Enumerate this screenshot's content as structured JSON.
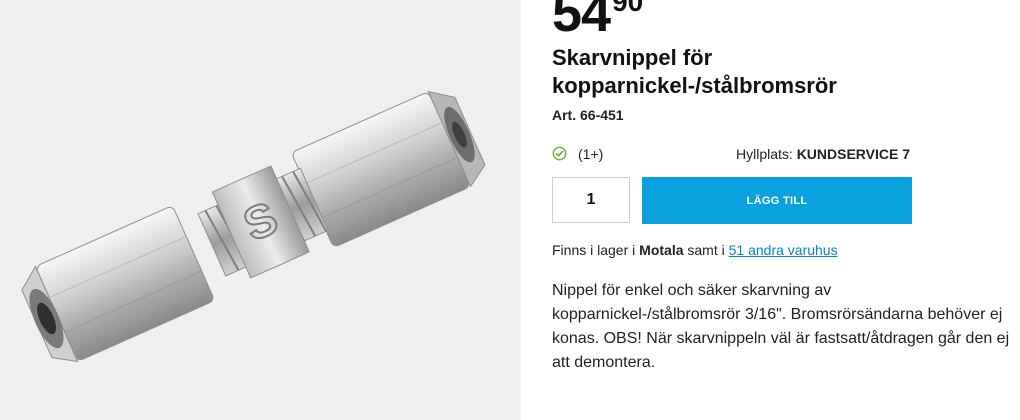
{
  "product": {
    "price_int": "54",
    "price_dec": "90",
    "title": "Skarvnippel för kopparnickel-/stålbromsrör",
    "art_no": "Art. 66-451",
    "rating_count": "(1+)",
    "shelf_label": "Hyllplats:",
    "shelf_value": "KUNDSERVICE 7",
    "quantity": "1",
    "add_button": "LÄGG TILL",
    "stock_prefix": "Finns i lager i",
    "stock_store": "Motala",
    "stock_middle": "samt i",
    "stock_link": "51 andra varuhus",
    "description": "Nippel för enkel och säker skarvning av kopparnickel-/stålbromsrör 3/16\". Bromsrörsändarna behöver ej konas. OBS! När skarvnippeln väl är fastsatt/åtdragen går den ej att demontera.",
    "image_emboss": "S"
  },
  "colors": {
    "accent": "#0ba1de",
    "link": "#0a82c4",
    "check": "#6cb33f",
    "image_bg": "#efefef"
  }
}
